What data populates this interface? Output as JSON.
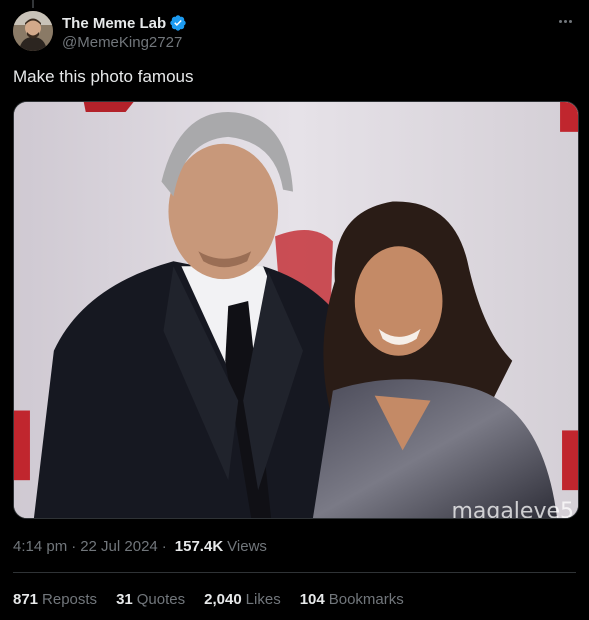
{
  "author": {
    "display_name": "The Meme Lab",
    "handle": "@MemeKing2727",
    "verified_icon": "verified-badge-icon",
    "verified_color": "#1d9bf0"
  },
  "tweet": {
    "text": "Make this photo famous",
    "media_alt": "photo",
    "watermark": "magaleve5"
  },
  "meta": {
    "time": "4:14 pm",
    "date": "22 Jul 2024",
    "views_count": "157.4K",
    "views_label": "Views",
    "separator": "·"
  },
  "stats": [
    {
      "count": "871",
      "label": "Reposts"
    },
    {
      "count": "31",
      "label": "Quotes"
    },
    {
      "count": "2,040",
      "label": "Likes"
    },
    {
      "count": "104",
      "label": "Bookmarks"
    }
  ],
  "colors": {
    "background": "#000000",
    "text_primary": "#e7e9ea",
    "text_secondary": "#71767b",
    "divider": "#2f3336"
  }
}
